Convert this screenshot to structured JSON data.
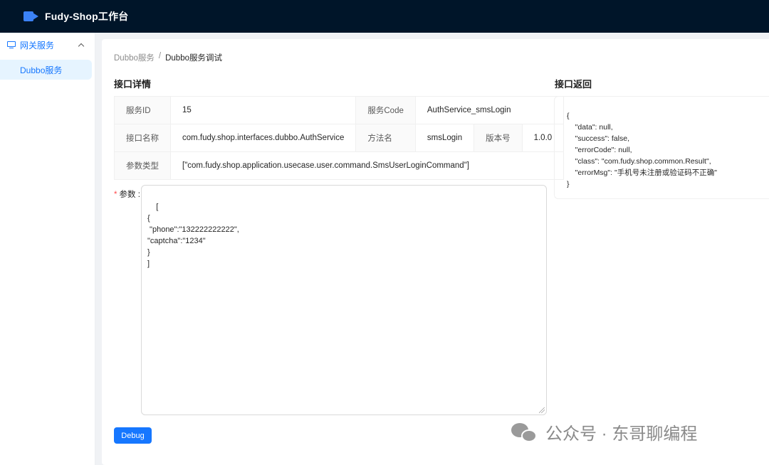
{
  "app": {
    "title": "Fudy-Shop工作台",
    "brand_color": "#001529",
    "accent_color": "#1677ff"
  },
  "sidebar": {
    "group_label": "网关服务",
    "group_icon": "monitor-icon",
    "items": [
      {
        "label": "Dubbo服务",
        "active": true
      }
    ]
  },
  "breadcrumb": {
    "parent": "Dubbo服务",
    "separator": "/",
    "current": "Dubbo服务调试"
  },
  "detail": {
    "title": "接口详情",
    "service_id_label": "服务ID",
    "service_id": "15",
    "service_code_label": "服务Code",
    "service_code": "AuthService_smsLogin",
    "interface_label": "接口名称",
    "interface_name": "com.fudy.shop.interfaces.dubbo.AuthService",
    "method_label": "方法名",
    "method_name": "smsLogin",
    "version_label": "版本号",
    "version": "1.0.0",
    "param_type_label": "参数类型",
    "param_type": "[\"com.fudy.shop.application.usecase.user.command.SmsUserLoginCommand\"]"
  },
  "params": {
    "required_mark": "*",
    "label": "参数",
    "colon": ":",
    "value": "[\n{\n \"phone\":\"132222222222\",\n\"captcha\":\"1234\"\n}\n]"
  },
  "debug_button": {
    "label": "Debug"
  },
  "response": {
    "title": "接口返回",
    "body": "{\n    \"data\": null,\n    \"success\": false,\n    \"errorCode\": null,\n    \"class\": \"com.fudy.shop.common.Result\",\n    \"errorMsg\": \"手机号未注册或验证码不正确\"\n}"
  },
  "watermark": {
    "text": "公众号 · 东哥聊编程",
    "icon": "wechat-icon"
  }
}
